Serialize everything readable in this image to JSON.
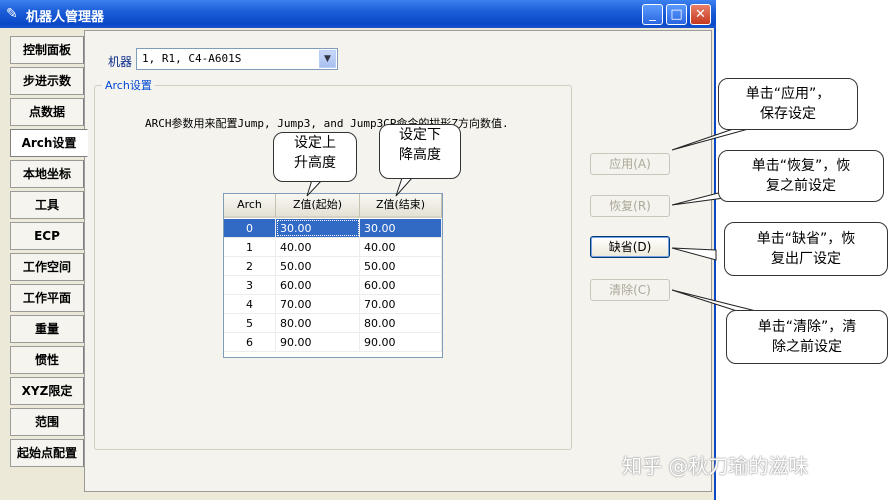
{
  "window": {
    "title": "机器人管理器"
  },
  "sidebar": {
    "items": [
      {
        "label": "控制面板",
        "active": false
      },
      {
        "label": "步进示数",
        "active": false
      },
      {
        "label": "点数据",
        "active": false
      },
      {
        "label": "Arch设置",
        "active": true
      },
      {
        "label": "本地坐标",
        "active": false
      },
      {
        "label": "工具",
        "active": false
      },
      {
        "label": "ECP",
        "active": false
      },
      {
        "label": "工作空间",
        "active": false
      },
      {
        "label": "工作平面",
        "active": false
      },
      {
        "label": "重量",
        "active": false
      },
      {
        "label": "惯性",
        "active": false
      },
      {
        "label": "XYZ限定",
        "active": false
      },
      {
        "label": "范围",
        "active": false
      },
      {
        "label": "起始点配置",
        "active": false
      }
    ]
  },
  "robot": {
    "label": "机器",
    "selected": "1, R1, C4-A601S"
  },
  "group": {
    "title": "Arch设置",
    "description": "ARCH参数用来配置Jump, Jump3, and Jump3CP命令的拱形Z方向数值."
  },
  "table": {
    "headers": [
      "Arch",
      "Z值(起始)",
      "Z值(结束)"
    ],
    "selected_row": 0,
    "rows": [
      [
        "0",
        "30.00",
        "30.00"
      ],
      [
        "1",
        "40.00",
        "40.00"
      ],
      [
        "2",
        "50.00",
        "50.00"
      ],
      [
        "3",
        "60.00",
        "60.00"
      ],
      [
        "4",
        "70.00",
        "70.00"
      ],
      [
        "5",
        "80.00",
        "80.00"
      ],
      [
        "6",
        "90.00",
        "90.00"
      ]
    ]
  },
  "buttons": {
    "apply": "应用(A)",
    "restore": "恢复(R)",
    "default": "缺省(D)",
    "clear": "清除(C)"
  },
  "callouts": {
    "rise": [
      "设定上",
      "升高度"
    ],
    "fall": [
      "设定下",
      "降高度"
    ],
    "apply": [
      "单击“应用”，",
      "保存设定"
    ],
    "restore": [
      "单击“恢复”，恢",
      "复之前设定"
    ],
    "default": [
      "单击“缺省”，恢",
      "复出厂设定"
    ],
    "clear": [
      "单击“清除”，清",
      "除之前设定"
    ]
  },
  "watermark": "知乎 @秋刀瑜的滋味",
  "colors": {
    "titlebar": "#0a48c8",
    "selection": "#316ac5",
    "close": "#c4391d"
  }
}
